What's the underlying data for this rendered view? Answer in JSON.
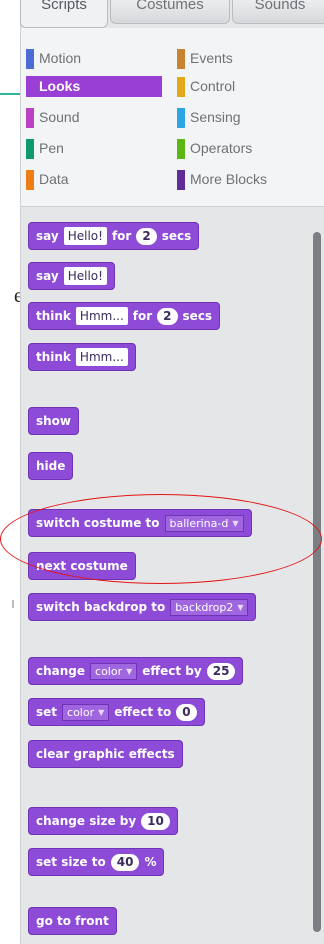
{
  "annotation": {
    "side_text": "e"
  },
  "tabs": [
    {
      "label": "Scripts",
      "active": true
    },
    {
      "label": "Costumes",
      "active": false
    },
    {
      "label": "Sounds",
      "active": false
    }
  ],
  "categories": [
    {
      "label": "Motion",
      "color": "#4a6cd4"
    },
    {
      "label": "Events",
      "color": "#c88330"
    },
    {
      "label": "Looks",
      "color": "#8a55d7",
      "selected": true
    },
    {
      "label": "Control",
      "color": "#e1a91a"
    },
    {
      "label": "Sound",
      "color": "#bb42c3"
    },
    {
      "label": "Sensing",
      "color": "#2ca5e2"
    },
    {
      "label": "Pen",
      "color": "#0e9a6c"
    },
    {
      "label": "Operators",
      "color": "#5cb712"
    },
    {
      "label": "Data",
      "color": "#ee7d16"
    },
    {
      "label": "More Blocks",
      "color": "#632d99"
    }
  ],
  "blocks": {
    "say_for": {
      "say": "say",
      "text": "Hello!",
      "for": "for",
      "num": "2",
      "secs": "secs"
    },
    "say": {
      "say": "say",
      "text": "Hello!"
    },
    "think_for": {
      "think": "think",
      "text": "Hmm...",
      "for": "for",
      "num": "2",
      "secs": "secs"
    },
    "think": {
      "think": "think",
      "text": "Hmm..."
    },
    "show": "show",
    "hide": "hide",
    "switch_costume": {
      "label": "switch costume to",
      "value": "ballerina-d"
    },
    "next_costume": "next costume",
    "switch_backdrop": {
      "label": "switch backdrop to",
      "value": "backdrop2"
    },
    "change_effect": {
      "change": "change",
      "effect": "color",
      "by": "effect by",
      "num": "25"
    },
    "set_effect": {
      "set": "set",
      "effect": "color",
      "to": "effect to",
      "num": "0"
    },
    "clear_effects": "clear graphic effects",
    "change_size": {
      "label": "change size by",
      "num": "10"
    },
    "set_size": {
      "label": "set size to",
      "num": "40",
      "unit": "%"
    },
    "go_front": "go to front"
  }
}
